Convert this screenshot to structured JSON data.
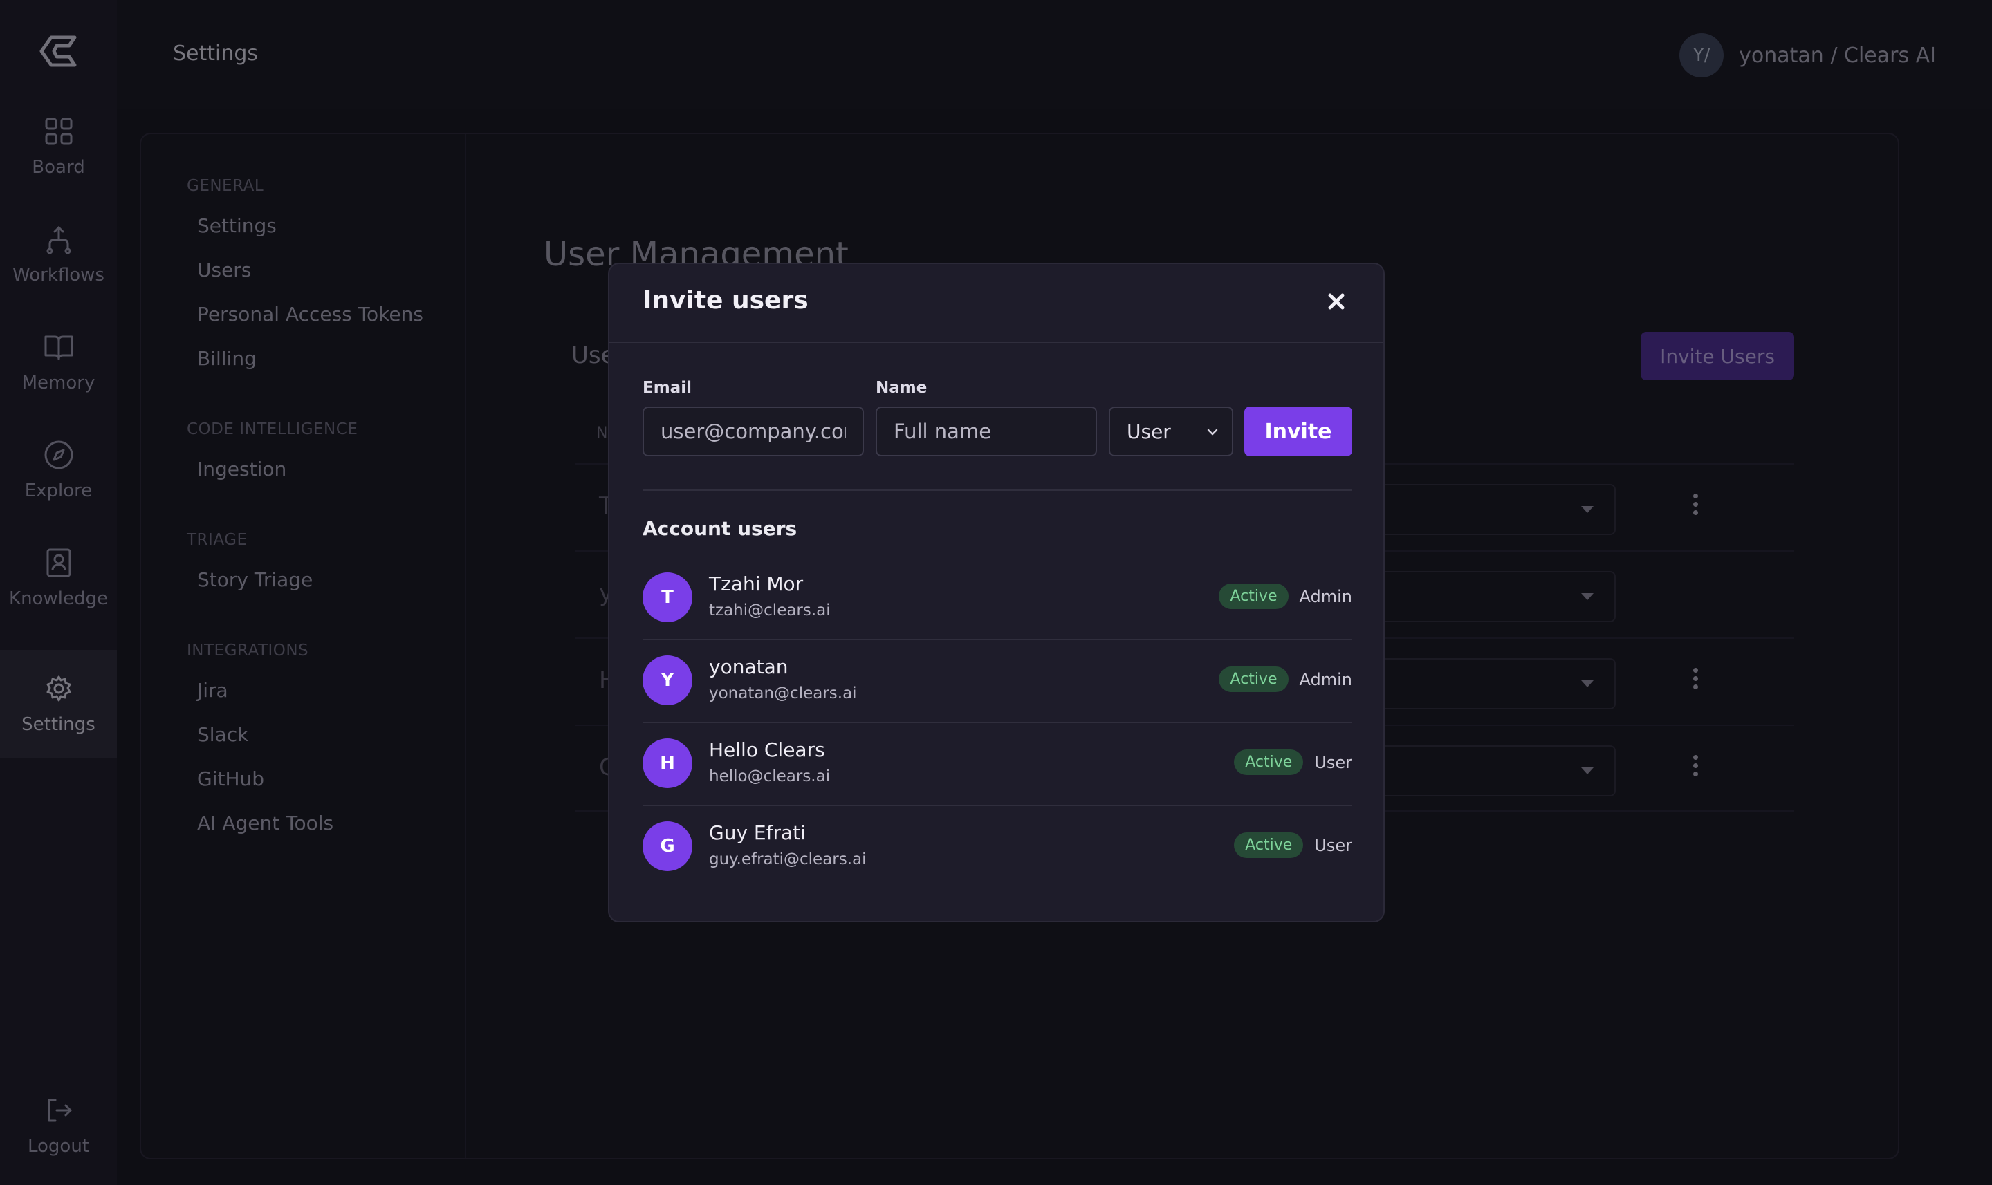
{
  "app": {
    "page_title": "Settings",
    "user_initials": "Y/",
    "user_label": "yonatan / Clears AI"
  },
  "rail": {
    "items": [
      {
        "label": "Board",
        "icon": "grid-icon"
      },
      {
        "label": "Workflows",
        "icon": "workflow-icon"
      },
      {
        "label": "Memory",
        "icon": "book-icon"
      },
      {
        "label": "Explore",
        "icon": "compass-icon"
      },
      {
        "label": "Knowledge",
        "icon": "contact-book-icon"
      },
      {
        "label": "Settings",
        "icon": "gear-icon",
        "active": true
      }
    ],
    "logout": "Logout"
  },
  "subnav": {
    "general": {
      "heading": "GENERAL",
      "items": [
        "Settings",
        "Users",
        "Personal Access Tokens",
        "Billing"
      ]
    },
    "code_intelligence": {
      "heading": "CODE INTELLIGENCE",
      "items": [
        "Ingestion"
      ]
    },
    "triage": {
      "heading": "TRIAGE",
      "items": [
        "Story Triage"
      ]
    },
    "integrations": {
      "heading": "INTEGRATIONS",
      "items": [
        "Jira",
        "Slack",
        "GitHub",
        "AI Agent Tools"
      ]
    }
  },
  "background": {
    "title": "User Management",
    "users_label": "Use",
    "invite_users_button": "Invite Users",
    "table_header": "N",
    "row_initials": [
      "T",
      "y",
      "H",
      "G"
    ]
  },
  "modal": {
    "title": "Invite users",
    "email_label": "Email",
    "email_placeholder": "user@company.com",
    "name_label": "Name",
    "name_placeholder": "Full name",
    "role_value": "User",
    "invite_button": "Invite",
    "section_title": "Account users",
    "users": [
      {
        "initial": "T",
        "name": "Tzahi Mor",
        "email": "tzahi@clears.ai",
        "status": "Active",
        "role": "Admin"
      },
      {
        "initial": "Y",
        "name": "yonatan",
        "email": "yonatan@clears.ai",
        "status": "Active",
        "role": "Admin"
      },
      {
        "initial": "H",
        "name": "Hello Clears",
        "email": "hello@clears.ai",
        "status": "Active",
        "role": "User"
      },
      {
        "initial": "G",
        "name": "Guy Efrati",
        "email": "guy.efrati@clears.ai",
        "status": "Active",
        "role": "User"
      }
    ]
  },
  "colors": {
    "accent": "#7a3ee8",
    "active_badge_bg": "#264a36",
    "active_badge_text": "#7ed39a"
  }
}
